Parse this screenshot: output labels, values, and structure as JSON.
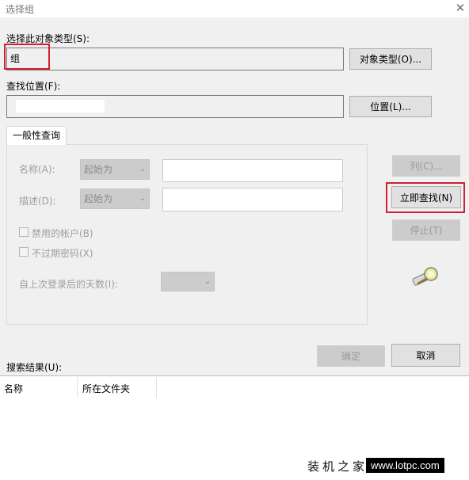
{
  "window": {
    "title": "选择组",
    "close_glyph": "✕"
  },
  "object_type": {
    "label": "选择此对象类型(S):",
    "value": "组",
    "button": "对象类型(O)..."
  },
  "location": {
    "label": "查找位置(F):",
    "value": "",
    "button": "位置(L)..."
  },
  "query": {
    "tab": "一般性查询",
    "name_label": "名称(A):",
    "name_mode": "起始为",
    "desc_label": "描述(D):",
    "desc_mode": "起始为",
    "disabled_accounts": "禁用的帐户(B)",
    "non_expiring": "不过期密码(X)",
    "days_label": "自上次登录后的天数(I):",
    "columns_button": "列(C)...",
    "find_now_button": "立即查找(N)",
    "stop_button": "停止(T)"
  },
  "actions": {
    "ok": "确定",
    "cancel": "取消"
  },
  "results": {
    "label": "搜索结果(U):",
    "columns": [
      "名称",
      "所在文件夹"
    ]
  },
  "watermark": {
    "site_name": "装机之家",
    "url": "www.lotpc.com"
  },
  "colors": {
    "highlight": "#d0212e",
    "window_bg": "#f0f0f0"
  }
}
